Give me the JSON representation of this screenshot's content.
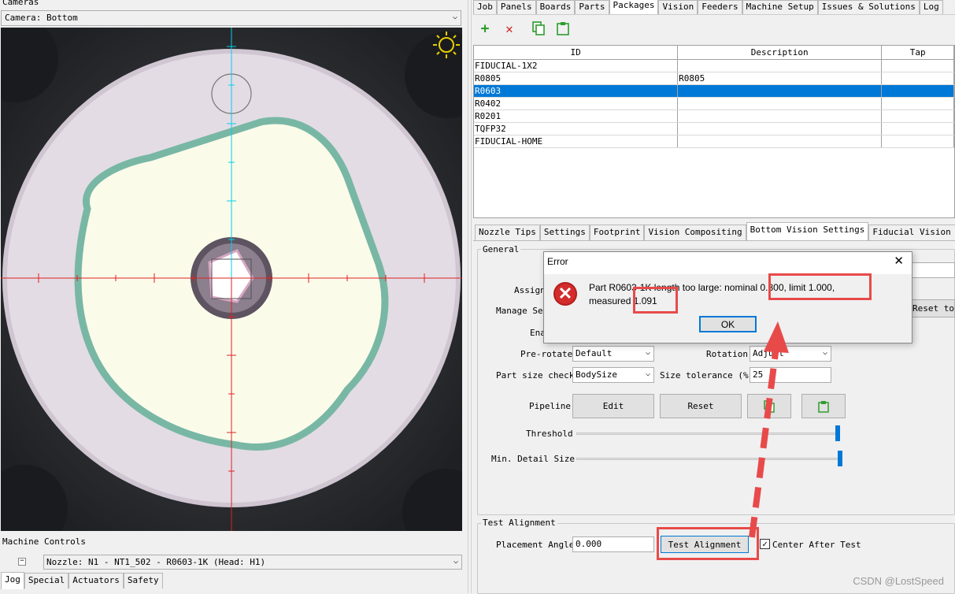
{
  "cameras": {
    "title": "Cameras",
    "selected": "Camera: Bottom"
  },
  "machine_controls": {
    "title": "Machine Controls",
    "nozzle": "Nozzle: N1 - NT1_502 - R0603-1K (Head: H1)",
    "tabs": [
      "Jog",
      "Special",
      "Actuators",
      "Safety"
    ]
  },
  "main_tabs": [
    "Job",
    "Panels",
    "Boards",
    "Parts",
    "Packages",
    "Vision",
    "Feeders",
    "Machine Setup",
    "Issues & Solutions",
    "Log"
  ],
  "packages": {
    "columns": [
      "ID",
      "Description",
      "Tap"
    ],
    "rows": [
      {
        "id": "FIDUCIAL-1X2",
        "description": ""
      },
      {
        "id": "R0805",
        "description": "R0805"
      },
      {
        "id": "R0603",
        "description": ""
      },
      {
        "id": "R0402",
        "description": ""
      },
      {
        "id": "R0201",
        "description": ""
      },
      {
        "id": "TQFP32",
        "description": ""
      },
      {
        "id": "FIDUCIAL-HOME",
        "description": ""
      }
    ]
  },
  "sub_tabs": [
    "Nozzle Tips",
    "Settings",
    "Footprint",
    "Vision Compositing",
    "Bottom Vision Settings",
    "Fiducial Vision Settings"
  ],
  "general": {
    "title": "General",
    "assign_label": "Assign",
    "manage_label": "Manage Set",
    "enabled_label": "Ena",
    "reset_label": "Reset to",
    "prerotate_label": "Pre-rotate",
    "prerotate_value": "Default",
    "rotation_label": "Rotation",
    "rotation_value": "Adjust",
    "partsize_label": "Part size check",
    "partsize_value": "BodySize",
    "tolerance_label": "Size tolerance (%)",
    "tolerance_value": "25",
    "pipeline_label": "Pipeline",
    "edit_label": "Edit",
    "reset_btn_label": "Reset",
    "threshold_label": "Threshold",
    "threshold_level": 0.99,
    "min_detail_label": "Min. Detail Size",
    "min_detail_level": 1.0
  },
  "test_alignment": {
    "title": "Test Alignment",
    "angle_label": "Placement Angle",
    "angle_value": "0.000",
    "button_label": "Test Alignment",
    "center_label": "Center After Test",
    "center_checked": true
  },
  "dialog": {
    "title": "Error",
    "close": "✕",
    "message": "Part R0603-1K length too large: nominal 0.800, limit 1.000, measured 1.091",
    "ok_label": "OK"
  },
  "watermark": "CSDN @LostSpeed",
  "colors": {
    "selection": "#0078d7",
    "highlight": "#e84a4a",
    "add_green": "#2e9e2e",
    "delete_red": "#d42020"
  }
}
